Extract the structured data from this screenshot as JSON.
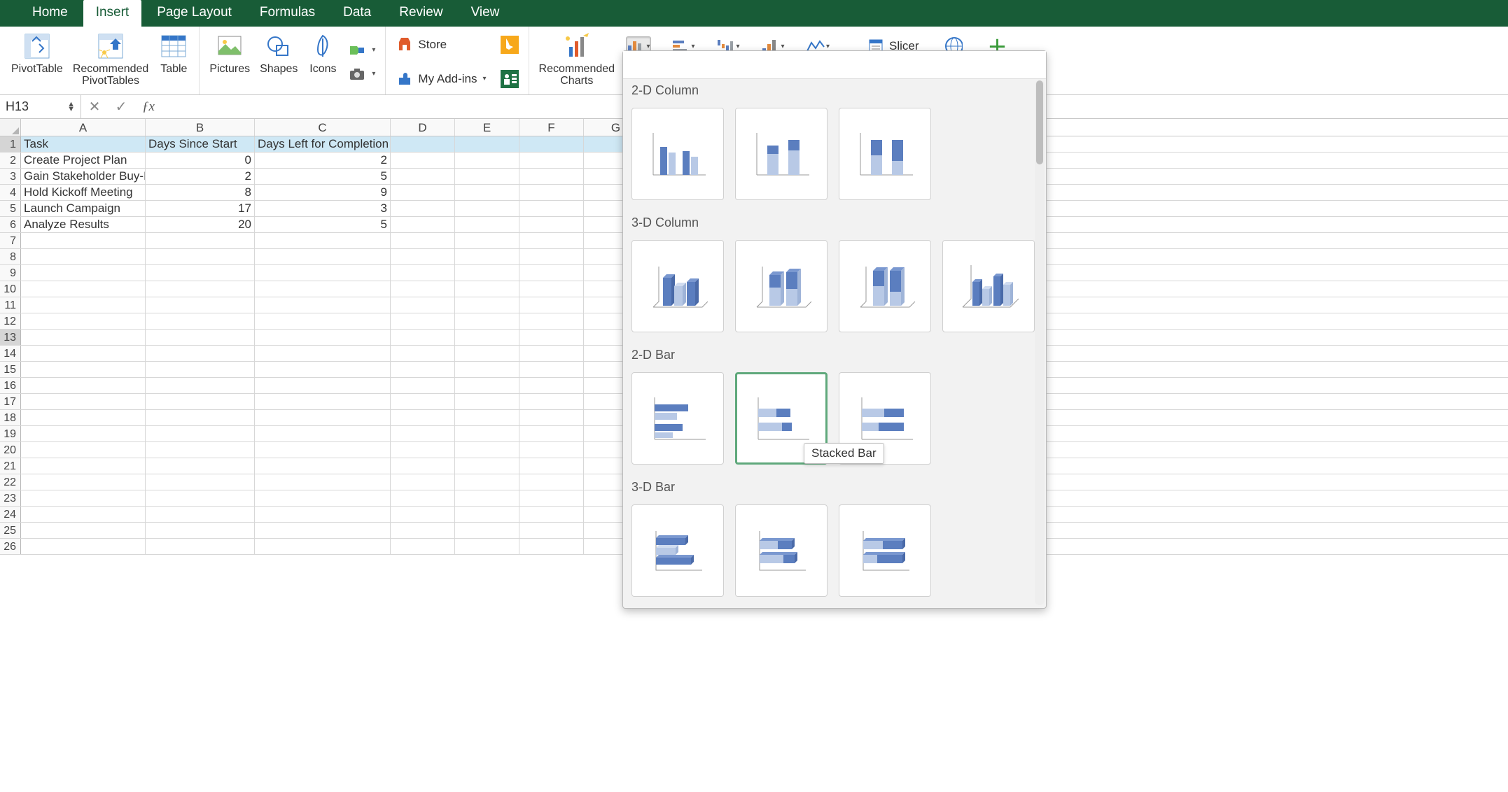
{
  "tabs": [
    "Home",
    "Insert",
    "Page Layout",
    "Formulas",
    "Data",
    "Review",
    "View"
  ],
  "active_tab": "Insert",
  "ribbon": {
    "pivottable": "PivotTable",
    "rec_pivottables": "Recommended\nPivotTables",
    "table": "Table",
    "pictures": "Pictures",
    "shapes": "Shapes",
    "icons": "Icons",
    "store": "Store",
    "myaddins": "My Add-ins",
    "rec_charts": "Recommended\nCharts",
    "slicer": "Slicer"
  },
  "name_box": "H13",
  "formula": "",
  "columns": [
    "A",
    "B",
    "C",
    "D",
    "E",
    "F",
    "G"
  ],
  "headers": {
    "A": "Task",
    "B": "Days Since Start",
    "C": "Days Left for Completion"
  },
  "rows": [
    {
      "A": "Create Project Plan",
      "B": 0,
      "C": 2
    },
    {
      "A": "Gain Stakeholder Buy-In",
      "B": 2,
      "C": 5
    },
    {
      "A": "Hold Kickoff Meeting",
      "B": 8,
      "C": 9
    },
    {
      "A": "Launch Campaign",
      "B": 17,
      "C": 3
    },
    {
      "A": "Analyze Results",
      "B": 20,
      "C": 5
    }
  ],
  "selected_cell": "H13",
  "selected_row": 13,
  "dropdown": {
    "sections": [
      "2-D Column",
      "3-D Column",
      "2-D Bar",
      "3-D Bar"
    ],
    "hover_item": "Stacked Bar"
  },
  "colors": {
    "accent": "#185c37",
    "chart_blue": "#5b7ebf",
    "chart_blue_light": "#b8c9e6"
  }
}
